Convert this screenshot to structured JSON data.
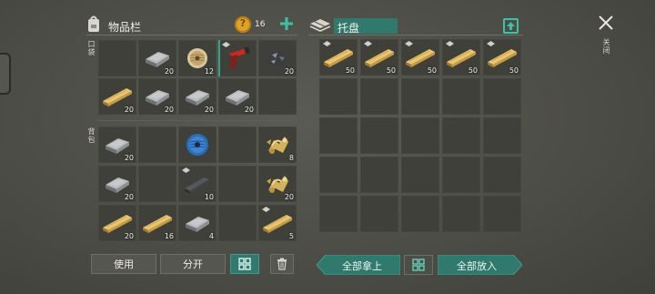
{
  "inventory": {
    "title": "物品栏",
    "coins": "16",
    "pocket_label": "口袋",
    "backpack_label": "背包",
    "pocket_slots": [
      {
        "item": "empty-slot",
        "count": ""
      },
      {
        "item": "iron-ingot-icon",
        "count": "20"
      },
      {
        "item": "wire-spool-icon",
        "count": "12"
      },
      {
        "item": "flare-gun-icon",
        "count": ""
      },
      {
        "item": "iron-ore-icon",
        "count": "20"
      },
      {
        "item": "wood-plank-icon",
        "count": "20"
      },
      {
        "item": "iron-ingot-icon",
        "count": "20"
      },
      {
        "item": "iron-ingot-icon",
        "count": "20"
      },
      {
        "item": "iron-ingot-icon",
        "count": "20"
      },
      {
        "item": "empty-slot",
        "count": ""
      }
    ],
    "backpack_slots": [
      {
        "item": "iron-ingot-icon",
        "count": "20"
      },
      {
        "item": "empty-slot",
        "count": ""
      },
      {
        "item": "blue-wire-spool-icon",
        "count": ""
      },
      {
        "item": "empty-slot",
        "count": ""
      },
      {
        "item": "gold-ornament-icon",
        "count": "8"
      },
      {
        "item": "iron-ingot-icon",
        "count": "20"
      },
      {
        "item": "empty-slot",
        "count": ""
      },
      {
        "item": "iron-bar-icon",
        "count": "10"
      },
      {
        "item": "empty-slot",
        "count": ""
      },
      {
        "item": "gold-ornament-icon",
        "count": "20"
      },
      {
        "item": "wood-plank-icon",
        "count": "20"
      },
      {
        "item": "wood-plank-icon",
        "count": "16"
      },
      {
        "item": "iron-ingot-icon",
        "count": "4"
      },
      {
        "item": "empty-slot",
        "count": ""
      },
      {
        "item": "wood-plank-icon",
        "count": "5"
      }
    ],
    "use_label": "使用",
    "split_label": "分开"
  },
  "pallet": {
    "title": "托盘",
    "slots_filled": [
      {
        "item": "wood-plank-icon",
        "count": "50"
      },
      {
        "item": "wood-plank-icon",
        "count": "50"
      },
      {
        "item": "wood-plank-icon",
        "count": "50"
      },
      {
        "item": "wood-plank-icon",
        "count": "50"
      },
      {
        "item": "wood-plank-icon",
        "count": "50"
      }
    ],
    "take_all_label": "全部拿上",
    "put_all_label": "全部放入"
  },
  "close_label": "关闭",
  "colors": {
    "accent": "#2f7a6c",
    "plus": "#3cc0a8",
    "background": "#4f5049",
    "slot": "#3f403a"
  }
}
